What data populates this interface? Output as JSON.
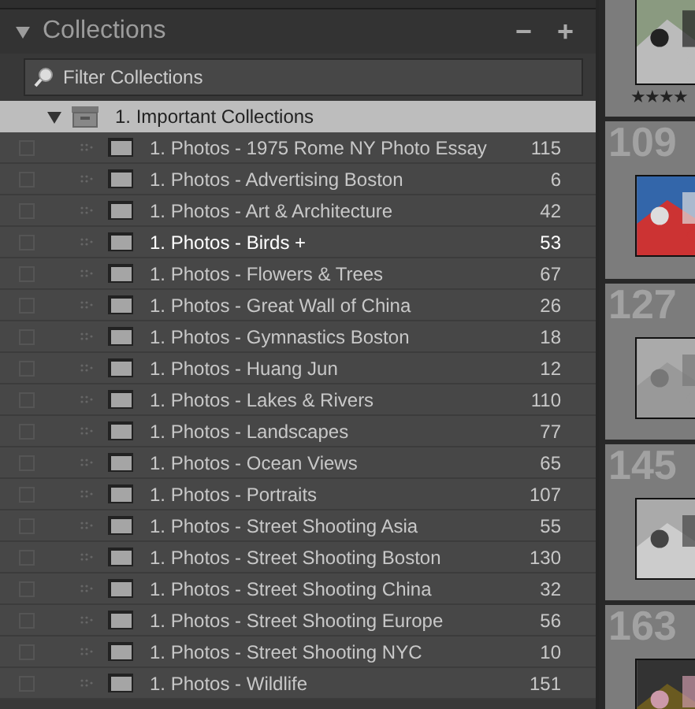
{
  "panel": {
    "title": "Collections",
    "expanded": true,
    "buttons": [
      "−",
      "+"
    ]
  },
  "filter": {
    "placeholder": "Filter Collections"
  },
  "group": {
    "name": "1. Important Collections",
    "expanded": true,
    "selected": true,
    "children": [
      {
        "name": "1. Photos - 1975 Rome NY Photo Essay",
        "count": "115",
        "checked": false,
        "target": false
      },
      {
        "name": "1. Photos - Advertising Boston",
        "count": "6",
        "checked": false,
        "target": false
      },
      {
        "name": "1. Photos - Art & Architecture",
        "count": "42",
        "checked": false,
        "target": false
      },
      {
        "name": "1. Photos - Birds  +",
        "count": "53",
        "checked": false,
        "target": true
      },
      {
        "name": "1. Photos - Flowers & Trees",
        "count": "67",
        "checked": false,
        "target": false
      },
      {
        "name": "1. Photos - Great Wall of China",
        "count": "26",
        "checked": false,
        "target": false
      },
      {
        "name": "1. Photos - Gymnastics Boston",
        "count": "18",
        "checked": false,
        "target": false
      },
      {
        "name": "1. Photos - Huang Jun",
        "count": "12",
        "checked": false,
        "target": false
      },
      {
        "name": "1. Photos - Lakes & Rivers",
        "count": "110",
        "checked": false,
        "target": false
      },
      {
        "name": "1. Photos - Landscapes",
        "count": "77",
        "checked": false,
        "target": false
      },
      {
        "name": "1. Photos - Ocean Views",
        "count": "65",
        "checked": false,
        "target": false
      },
      {
        "name": "1. Photos - Portraits",
        "count": "107",
        "checked": false,
        "target": false
      },
      {
        "name": "1. Photos - Street Shooting Asia",
        "count": "55",
        "checked": false,
        "target": false
      },
      {
        "name": "1. Photos - Street Shooting Boston",
        "count": "130",
        "checked": false,
        "target": false
      },
      {
        "name": "1. Photos - Street Shooting China",
        "count": "32",
        "checked": false,
        "target": false
      },
      {
        "name": "1. Photos - Street Shooting Europe",
        "count": "56",
        "checked": false,
        "target": false
      },
      {
        "name": "1. Photos - Street Shooting NYC",
        "count": "10",
        "checked": false,
        "target": false
      },
      {
        "name": "1. Photos - Wildlife",
        "count": "151",
        "checked": false,
        "target": false
      }
    ]
  },
  "grid": {
    "cells": [
      {
        "stars": 4,
        "kind": "picture"
      },
      {
        "number": "109",
        "kind": "picture"
      },
      {
        "number": "127",
        "kind": "picture"
      },
      {
        "number": "145",
        "kind": "picture"
      },
      {
        "number": "163",
        "kind": "picture"
      }
    ]
  }
}
